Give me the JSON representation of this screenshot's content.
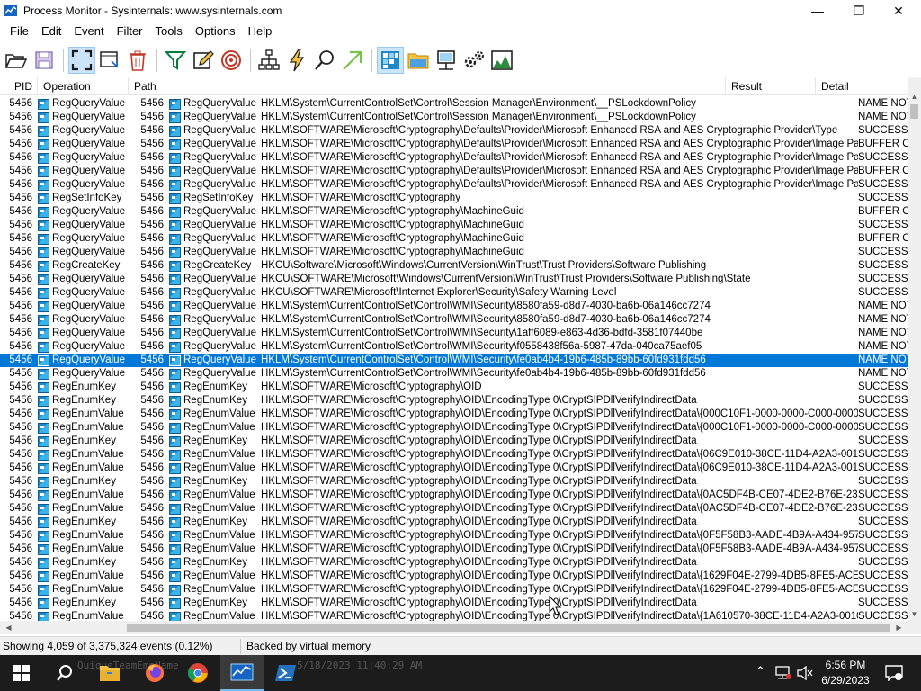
{
  "window": {
    "title": "Process Monitor - Sysinternals: www.sysinternals.com",
    "minimize": "—",
    "maximize": "❐",
    "close": "✕"
  },
  "menu": [
    "File",
    "Edit",
    "Event",
    "Filter",
    "Tools",
    "Options",
    "Help"
  ],
  "toolbar_icons": [
    "open-icon",
    "save-icon",
    "capture-icon",
    "autoscroll-icon",
    "clear-icon",
    "filter-icon",
    "highlight-icon",
    "target-icon",
    "process-tree-icon",
    "jump-icon",
    "find-icon",
    "jump-to-icon",
    "registry-activity-icon",
    "filesystem-activity-icon",
    "network-activity-icon",
    "process-activity-icon",
    "profiling-activity-icon"
  ],
  "columns": {
    "pid": "PID",
    "operation": "Operation",
    "path": "Path",
    "result": "Result",
    "detail": "Detail"
  },
  "rows": [
    {
      "pid": "5456",
      "op": "RegQueryValue",
      "path": "HKLM\\System\\CurrentControlSet\\Control\\Session Manager\\Environment\\__PSLockdownPolicy",
      "result": "NAME NOT"
    },
    {
      "pid": "5456",
      "op": "RegQueryValue",
      "path": "HKLM\\System\\CurrentControlSet\\Control\\Session Manager\\Environment\\__PSLockdownPolicy",
      "result": "NAME NOT"
    },
    {
      "pid": "5456",
      "op": "RegQueryValue",
      "path": "HKLM\\SOFTWARE\\Microsoft\\Cryptography\\Defaults\\Provider\\Microsoft Enhanced RSA and AES Cryptographic Provider\\Type",
      "result": "SUCCESS"
    },
    {
      "pid": "5456",
      "op": "RegQueryValue",
      "path": "HKLM\\SOFTWARE\\Microsoft\\Cryptography\\Defaults\\Provider\\Microsoft Enhanced RSA and AES Cryptographic Provider\\Image Path",
      "result": "BUFFER O"
    },
    {
      "pid": "5456",
      "op": "RegQueryValue",
      "path": "HKLM\\SOFTWARE\\Microsoft\\Cryptography\\Defaults\\Provider\\Microsoft Enhanced RSA and AES Cryptographic Provider\\Image Path",
      "result": "SUCCESS"
    },
    {
      "pid": "5456",
      "op": "RegQueryValue",
      "path": "HKLM\\SOFTWARE\\Microsoft\\Cryptography\\Defaults\\Provider\\Microsoft Enhanced RSA and AES Cryptographic Provider\\Image Path",
      "result": "BUFFER O"
    },
    {
      "pid": "5456",
      "op": "RegQueryValue",
      "path": "HKLM\\SOFTWARE\\Microsoft\\Cryptography\\Defaults\\Provider\\Microsoft Enhanced RSA and AES Cryptographic Provider\\Image Path",
      "result": "SUCCESS"
    },
    {
      "pid": "5456",
      "op": "RegSetInfoKey",
      "path": "HKLM\\SOFTWARE\\Microsoft\\Cryptography",
      "result": "SUCCESS"
    },
    {
      "pid": "5456",
      "op": "RegQueryValue",
      "path": "HKLM\\SOFTWARE\\Microsoft\\Cryptography\\MachineGuid",
      "result": "BUFFER O"
    },
    {
      "pid": "5456",
      "op": "RegQueryValue",
      "path": "HKLM\\SOFTWARE\\Microsoft\\Cryptography\\MachineGuid",
      "result": "SUCCESS"
    },
    {
      "pid": "5456",
      "op": "RegQueryValue",
      "path": "HKLM\\SOFTWARE\\Microsoft\\Cryptography\\MachineGuid",
      "result": "BUFFER O"
    },
    {
      "pid": "5456",
      "op": "RegQueryValue",
      "path": "HKLM\\SOFTWARE\\Microsoft\\Cryptography\\MachineGuid",
      "result": "SUCCESS"
    },
    {
      "pid": "5456",
      "op": "RegCreateKey",
      "path": "HKCU\\Software\\Microsoft\\Windows\\CurrentVersion\\WinTrust\\Trust Providers\\Software Publishing",
      "result": "SUCCESS"
    },
    {
      "pid": "5456",
      "op": "RegQueryValue",
      "path": "HKCU\\SOFTWARE\\Microsoft\\Windows\\CurrentVersion\\WinTrust\\Trust Providers\\Software Publishing\\State",
      "result": "SUCCESS"
    },
    {
      "pid": "5456",
      "op": "RegQueryValue",
      "path": "HKCU\\SOFTWARE\\Microsoft\\Internet Explorer\\Security\\Safety Warning Level",
      "result": "SUCCESS"
    },
    {
      "pid": "5456",
      "op": "RegQueryValue",
      "path": "HKLM\\System\\CurrentControlSet\\Control\\WMI\\Security\\8580fa59-d8d7-4030-ba6b-06a146cc7274",
      "result": "NAME NOT"
    },
    {
      "pid": "5456",
      "op": "RegQueryValue",
      "path": "HKLM\\System\\CurrentControlSet\\Control\\WMI\\Security\\8580fa59-d8d7-4030-ba6b-06a146cc7274",
      "result": "NAME NOT"
    },
    {
      "pid": "5456",
      "op": "RegQueryValue",
      "path": "HKLM\\System\\CurrentControlSet\\Control\\WMI\\Security\\1aff6089-e863-4d36-bdfd-3581f07440be",
      "result": "NAME NOT"
    },
    {
      "pid": "5456",
      "op": "RegQueryValue",
      "path": "HKLM\\System\\CurrentControlSet\\Control\\WMI\\Security\\f0558438f56a-5987-47da-040ca75aef05",
      "result": "NAME NOT"
    },
    {
      "pid": "5456",
      "op": "RegQueryValue",
      "path": "HKLM\\System\\CurrentControlSet\\Control\\WMI\\Security\\fe0ab4b4-19b6-485b-89bb-60fd931fdd56",
      "result": "NAME NOT",
      "selected": true
    },
    {
      "pid": "5456",
      "op": "RegQueryValue",
      "path": "HKLM\\System\\CurrentControlSet\\Control\\WMI\\Security\\fe0ab4b4-19b6-485b-89bb-60fd931fdd56",
      "result": "NAME NOT"
    },
    {
      "pid": "5456",
      "op": "RegEnumKey",
      "path": "HKLM\\SOFTWARE\\Microsoft\\Cryptography\\OID",
      "result": "SUCCESS"
    },
    {
      "pid": "5456",
      "op": "RegEnumKey",
      "path": "HKLM\\SOFTWARE\\Microsoft\\Cryptography\\OID\\EncodingType 0\\CryptSIPDllVerifyIndirectData",
      "result": "SUCCESS"
    },
    {
      "pid": "5456",
      "op": "RegEnumValue",
      "path": "HKLM\\SOFTWARE\\Microsoft\\Cryptography\\OID\\EncodingType 0\\CryptSIPDllVerifyIndirectData\\{000C10F1-0000-0000-C000-000000000...",
      "result": "SUCCESS"
    },
    {
      "pid": "5456",
      "op": "RegEnumValue",
      "path": "HKLM\\SOFTWARE\\Microsoft\\Cryptography\\OID\\EncodingType 0\\CryptSIPDllVerifyIndirectData\\{000C10F1-0000-0000-C000-000000000...",
      "result": "SUCCESS"
    },
    {
      "pid": "5456",
      "op": "RegEnumKey",
      "path": "HKLM\\SOFTWARE\\Microsoft\\Cryptography\\OID\\EncodingType 0\\CryptSIPDllVerifyIndirectData",
      "result": "SUCCESS"
    },
    {
      "pid": "5456",
      "op": "RegEnumValue",
      "path": "HKLM\\SOFTWARE\\Microsoft\\Cryptography\\OID\\EncodingType 0\\CryptSIPDllVerifyIndirectData\\{06C9E010-38CE-11D4-A2A3-00104BD...",
      "result": "SUCCESS"
    },
    {
      "pid": "5456",
      "op": "RegEnumValue",
      "path": "HKLM\\SOFTWARE\\Microsoft\\Cryptography\\OID\\EncodingType 0\\CryptSIPDllVerifyIndirectData\\{06C9E010-38CE-11D4-A2A3-00104BD...",
      "result": "SUCCESS"
    },
    {
      "pid": "5456",
      "op": "RegEnumKey",
      "path": "HKLM\\SOFTWARE\\Microsoft\\Cryptography\\OID\\EncodingType 0\\CryptSIPDllVerifyIndirectData",
      "result": "SUCCESS"
    },
    {
      "pid": "5456",
      "op": "RegEnumValue",
      "path": "HKLM\\SOFTWARE\\Microsoft\\Cryptography\\OID\\EncodingType 0\\CryptSIPDllVerifyIndirectData\\{0AC5DF4B-CE07-4DE2-B76E-23C839...",
      "result": "SUCCESS"
    },
    {
      "pid": "5456",
      "op": "RegEnumValue",
      "path": "HKLM\\SOFTWARE\\Microsoft\\Cryptography\\OID\\EncodingType 0\\CryptSIPDllVerifyIndirectData\\{0AC5DF4B-CE07-4DE2-B76E-23C839...",
      "result": "SUCCESS"
    },
    {
      "pid": "5456",
      "op": "RegEnumKey",
      "path": "HKLM\\SOFTWARE\\Microsoft\\Cryptography\\OID\\EncodingType 0\\CryptSIPDllVerifyIndirectData",
      "result": "SUCCESS"
    },
    {
      "pid": "5456",
      "op": "RegEnumValue",
      "path": "HKLM\\SOFTWARE\\Microsoft\\Cryptography\\OID\\EncodingType 0\\CryptSIPDllVerifyIndirectData\\{0F5F58B3-AADE-4B9A-A434-95742D9...",
      "result": "SUCCESS"
    },
    {
      "pid": "5456",
      "op": "RegEnumValue",
      "path": "HKLM\\SOFTWARE\\Microsoft\\Cryptography\\OID\\EncodingType 0\\CryptSIPDllVerifyIndirectData\\{0F5F58B3-AADE-4B9A-A434-95742D9...",
      "result": "SUCCESS"
    },
    {
      "pid": "5456",
      "op": "RegEnumKey",
      "path": "HKLM\\SOFTWARE\\Microsoft\\Cryptography\\OID\\EncodingType 0\\CryptSIPDllVerifyIndirectData",
      "result": "SUCCESS"
    },
    {
      "pid": "5456",
      "op": "RegEnumValue",
      "path": "HKLM\\SOFTWARE\\Microsoft\\Cryptography\\OID\\EncodingType 0\\CryptSIPDllVerifyIndirectData\\{1629F04E-2799-4DB5-8FE5-ACE10F1...",
      "result": "SUCCESS"
    },
    {
      "pid": "5456",
      "op": "RegEnumValue",
      "path": "HKLM\\SOFTWARE\\Microsoft\\Cryptography\\OID\\EncodingType 0\\CryptSIPDllVerifyIndirectData\\{1629F04E-2799-4DB5-8FE5-ACE10F1...",
      "result": "SUCCESS"
    },
    {
      "pid": "5456",
      "op": "RegEnumKey",
      "path": "HKLM\\SOFTWARE\\Microsoft\\Cryptography\\OID\\EncodingType 0\\CryptSIPDllVerifyIndirectData",
      "result": "SUCCESS"
    },
    {
      "pid": "5456",
      "op": "RegEnumValue",
      "path": "HKLM\\SOFTWARE\\Microsoft\\Cryptography\\OID\\EncodingType 0\\CryptSIPDllVerifyIndirectData\\{1A610570-38CE-11D4-A2A3-00104BD...",
      "result": "SUCCESS"
    }
  ],
  "status": {
    "events": "Showing 4,059 of 3,375,324 events (0.12%)",
    "memory": "Backed by virtual memory"
  },
  "taskbar": {
    "ghost_text_1": "QuiqueTeamEmpName",
    "ghost_text_2": "5/18/2023 11:40:29 AM",
    "time": "6:56 PM",
    "date": "6/29/2023",
    "apps": [
      "start-icon",
      "search-icon",
      "file-explorer-icon",
      "firefox-icon",
      "chrome-icon",
      "process-monitor-icon",
      "powershell-icon"
    ]
  },
  "colors": {
    "selection": "#0078d7",
    "taskbar": "#1c1c1c",
    "registry_icon": "#1e88c8"
  }
}
